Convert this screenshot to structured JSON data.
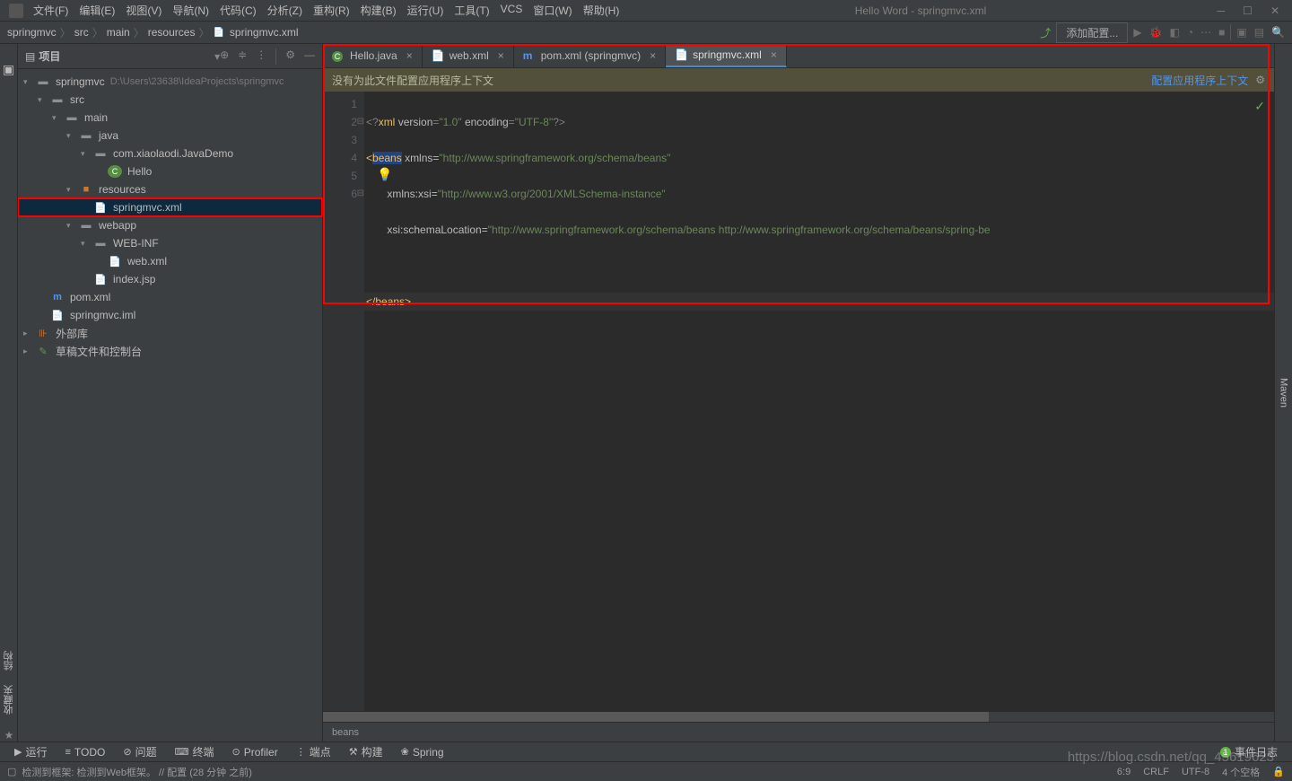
{
  "menus": [
    "文件(F)",
    "编辑(E)",
    "视图(V)",
    "导航(N)",
    "代码(C)",
    "分析(Z)",
    "重构(R)",
    "构建(B)",
    "运行(U)",
    "工具(T)",
    "VCS",
    "窗口(W)",
    "帮助(H)"
  ],
  "window_title": "Hello Word - springmvc.xml",
  "breadcrumb": [
    "springmvc",
    "src",
    "main",
    "resources",
    "springmvc.xml"
  ],
  "add_config": "添加配置...",
  "sidebar": {
    "title": "项目",
    "tree": [
      {
        "ind": 0,
        "chev": "▾",
        "icon": "folder-blue",
        "label": "springmvc",
        "extra": "D:\\Users\\23638\\IdeaProjects\\springmvc"
      },
      {
        "ind": 1,
        "chev": "▾",
        "icon": "folder-blue",
        "label": "src"
      },
      {
        "ind": 2,
        "chev": "▾",
        "icon": "folder-blue",
        "label": "main"
      },
      {
        "ind": 3,
        "chev": "▾",
        "icon": "folder-blue",
        "label": "java"
      },
      {
        "ind": 4,
        "chev": "▾",
        "icon": "folder-blue",
        "label": "com.xiaolaodi.JavaDemo"
      },
      {
        "ind": 5,
        "chev": "",
        "icon": "file-c",
        "label": "Hello"
      },
      {
        "ind": 3,
        "chev": "▾",
        "icon": "folder-orange",
        "label": "resources"
      },
      {
        "ind": 4,
        "chev": "",
        "icon": "file-x",
        "label": "springmvc.xml",
        "selected": true,
        "red": true
      },
      {
        "ind": 3,
        "chev": "▾",
        "icon": "folder-blue",
        "label": "webapp"
      },
      {
        "ind": 4,
        "chev": "▾",
        "icon": "folder-blue",
        "label": "WEB-INF"
      },
      {
        "ind": 5,
        "chev": "",
        "icon": "file-x",
        "label": "web.xml"
      },
      {
        "ind": 4,
        "chev": "",
        "icon": "file-x",
        "label": "index.jsp"
      },
      {
        "ind": 1,
        "chev": "",
        "icon": "file-m",
        "label": "pom.xml"
      },
      {
        "ind": 1,
        "chev": "",
        "icon": "file-x",
        "label": "springmvc.iml"
      },
      {
        "ind": 0,
        "chev": "▸",
        "icon": "lib",
        "label": "外部库"
      },
      {
        "ind": 0,
        "chev": "▸",
        "icon": "scratch",
        "label": "草稿文件和控制台"
      }
    ]
  },
  "tabs": [
    {
      "icon": "c",
      "label": "Hello.java"
    },
    {
      "icon": "x",
      "label": "web.xml"
    },
    {
      "icon": "m",
      "label": "pom.xml (springmvc)"
    },
    {
      "icon": "x",
      "label": "springmvc.xml",
      "active": true
    }
  ],
  "banner": {
    "msg": "没有为此文件配置应用程序上下文",
    "link": "配置应用程序上下文"
  },
  "code": {
    "l1": "<?xml version=\"1.0\" encoding=\"UTF-8\"?>",
    "l2a": "<beans",
    "l2b": "xmlns",
    "l2c": "\"http://www.springframework.org/schema/beans\"",
    "l3a": "xmlns:xsi",
    "l3b": "\"http://www.w3.org/2001/XMLSchema-instance\"",
    "l4a": "xsi:schemaLocation",
    "l4b": "\"http://www.springframework.org/schema/beans http://www.springframework.org/schema/beans/spring-be",
    "l6": "</beans>"
  },
  "crumb_editor": "beans",
  "toolwindows": [
    {
      "ico": "▶",
      "label": "运行"
    },
    {
      "ico": "≡",
      "label": "TODO"
    },
    {
      "ico": "⊘",
      "label": "问题"
    },
    {
      "ico": "⌨",
      "label": "终端"
    },
    {
      "ico": "⊙",
      "label": "Profiler"
    },
    {
      "ico": "⋮",
      "label": "端点"
    },
    {
      "ico": "⚒",
      "label": "构建"
    },
    {
      "ico": "❀",
      "label": "Spring"
    }
  ],
  "event_log": "事件日志",
  "status": {
    "left": "检测到框架: 检测到Web框架。 // 配置 (28 分钟 之前)",
    "pos": "6:9",
    "sep": "CRLF",
    "enc": "UTF-8",
    "spc": "4 个空格"
  },
  "side_tabs": {
    "structure": "结构",
    "favorite": "收藏夹",
    "maven": "Maven"
  },
  "watermark": "https://blog.csdn.net/qq_45619623"
}
